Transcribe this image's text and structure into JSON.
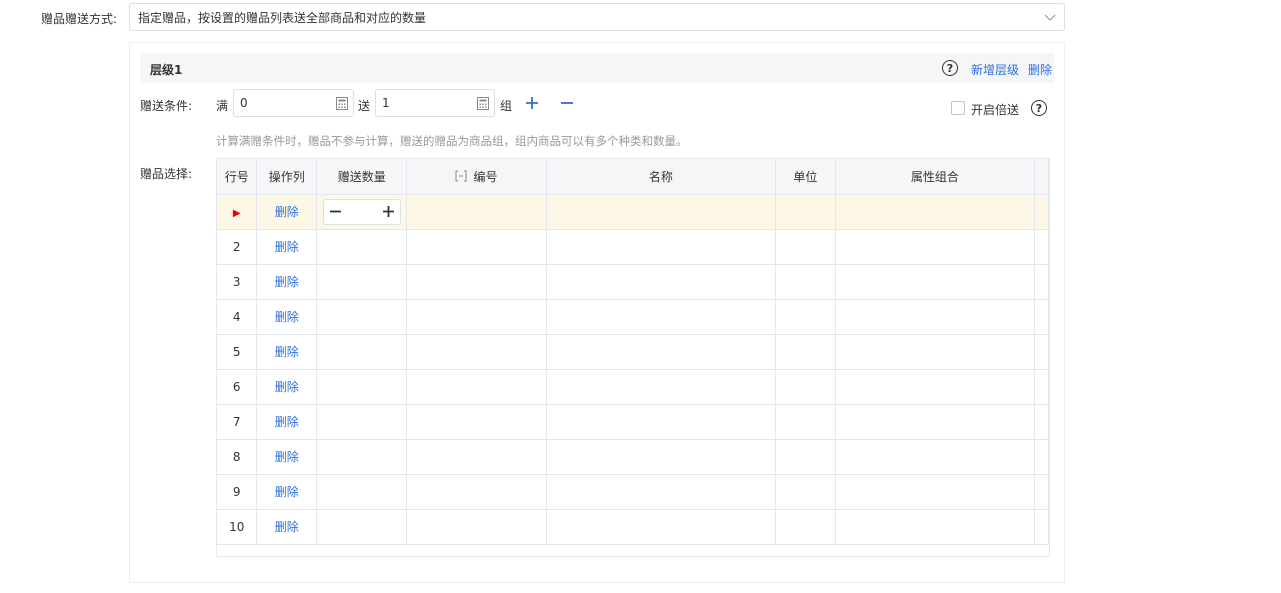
{
  "gift_mode": {
    "label": "赠品赠送方式:",
    "value": "指定赠品，按设置的赠品列表送全部商品和对应的数量"
  },
  "level": {
    "title": "层级1",
    "help_glyph": "?",
    "add_label": "新增层级",
    "delete_label": "删除"
  },
  "condition": {
    "label": "赠送条件:",
    "full_prefix": "满",
    "full_value": "0",
    "give_prefix": "送",
    "give_value": "1",
    "group_suffix": "组",
    "double_label": "开启倍送",
    "hint": "计算满赠条件时，赠品不参与计算，赠送的赠品为商品组，组内商品可以有多个种类和数量。"
  },
  "gift_select": {
    "label": "赠品选择:",
    "columns": [
      "行号",
      "操作列",
      "赠送数量",
      "编号",
      "名称",
      "单位",
      "属性组合"
    ],
    "rows": [
      {
        "no": "",
        "action": "删除"
      },
      {
        "no": "2",
        "action": "删除"
      },
      {
        "no": "3",
        "action": "删除"
      },
      {
        "no": "4",
        "action": "删除"
      },
      {
        "no": "5",
        "action": "删除"
      },
      {
        "no": "6",
        "action": "删除"
      },
      {
        "no": "7",
        "action": "删除"
      },
      {
        "no": "8",
        "action": "删除"
      },
      {
        "no": "9",
        "action": "删除"
      },
      {
        "no": "10",
        "action": "删除"
      }
    ],
    "selected_marker": "▶"
  },
  "colors": {
    "link": "#2f6fdc",
    "selected_row": "#fdf8e6",
    "pointer": "#ee0000"
  }
}
